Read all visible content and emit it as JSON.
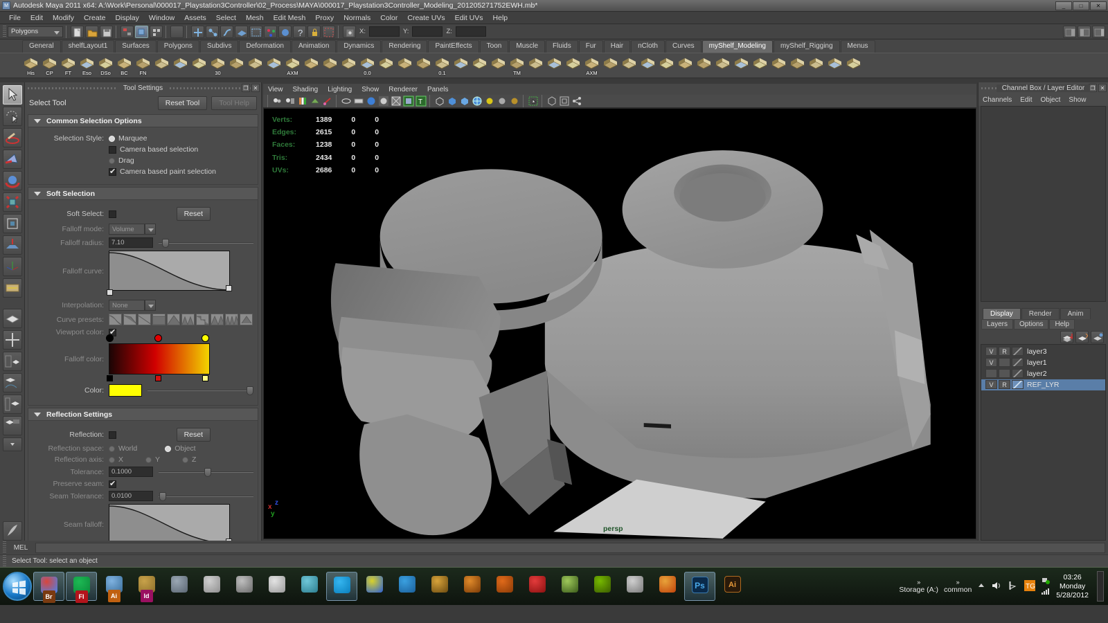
{
  "titlebar": {
    "title": "Autodesk Maya 2011 x64: A:\\Work\\Personal\\000017_Playstation3Controller\\02_Process\\MAYA\\000017_Playstation3Controller_Modeling_201205271752EWH.mb*",
    "minimize": "_",
    "maximize": "□",
    "close": "✕"
  },
  "menubar": {
    "items": [
      "File",
      "Edit",
      "Modify",
      "Create",
      "Display",
      "Window",
      "Assets",
      "Select",
      "Mesh",
      "Edit Mesh",
      "Proxy",
      "Normals",
      "Color",
      "Create UVs",
      "Edit UVs",
      "Help"
    ]
  },
  "statusline": {
    "menuset": "Polygons",
    "coord_labels": [
      "X:",
      "Y:",
      "Z:"
    ],
    "coord_values": [
      "",
      "",
      ""
    ]
  },
  "shelf": {
    "tabs": [
      "General",
      "shelfLayout1",
      "Surfaces",
      "Polygons",
      "Subdivs",
      "Deformation",
      "Animation",
      "Dynamics",
      "Rendering",
      "PaintEffects",
      "Toon",
      "Muscle",
      "Fluids",
      "Fur",
      "Hair",
      "nCloth",
      "Curves",
      "myShelf_Modeling",
      "myShelf_Rigging",
      "Menus"
    ],
    "active_tab": "myShelf_Modeling",
    "button_labels": [
      "His",
      "CP",
      "FT",
      "Eso",
      "DSo",
      "BC",
      "FN"
    ],
    "extra_labels": [
      "30",
      "AXM",
      "0.0",
      "0.1",
      "TM",
      "AXM"
    ]
  },
  "toolsettings": {
    "panel_title": "Tool Settings",
    "tool_name": "Select Tool",
    "reset_tool": "Reset Tool",
    "tool_help": "Tool Help",
    "common": {
      "frame": "Common Selection Options",
      "selection_style_label": "Selection Style:",
      "marquee": "Marquee",
      "camera_based_selection": "Camera based selection",
      "drag": "Drag",
      "camera_based_paint_selection": "Camera based paint selection",
      "marquee_checked": true,
      "drag_checked": false,
      "cbs_checked": false,
      "cbps_checked": true
    },
    "soft": {
      "frame": "Soft Selection",
      "soft_select_label": "Soft Select:",
      "reset": "Reset",
      "falloff_mode_label": "Falloff mode:",
      "falloff_mode_value": "Volume",
      "falloff_radius_label": "Falloff radius:",
      "falloff_radius_value": "7.10",
      "falloff_curve_label": "Falloff curve:",
      "interpolation_label": "Interpolation:",
      "interpolation_value": "None",
      "curve_presets_label": "Curve presets:",
      "viewport_color_label": "Viewport color:",
      "viewport_color_checked": true,
      "falloff_color_label": "Falloff color:",
      "color_label": "Color:",
      "color_value": "#ffff00",
      "gradient_stops": [
        "#000000",
        "#e00000",
        "#ffff00"
      ]
    },
    "reflection": {
      "frame": "Reflection Settings",
      "reflection_label": "Reflection:",
      "reset": "Reset",
      "space_label": "Reflection space:",
      "world": "World",
      "object": "Object",
      "space_value": "Object",
      "axis_label": "Reflection axis:",
      "axis_x": "X",
      "axis_y": "Y",
      "axis_z": "Z",
      "axis_value": "X",
      "tolerance_label": "Tolerance:",
      "tolerance_value": "0.1000",
      "preserve_seam_label": "Preserve seam:",
      "preserve_seam_checked": true,
      "seam_tolerance_label": "Seam Tolerance:",
      "seam_tolerance_value": "0.0100",
      "seam_falloff_label": "Seam falloff:"
    }
  },
  "viewport": {
    "menus": [
      "View",
      "Shading",
      "Lighting",
      "Show",
      "Renderer",
      "Panels"
    ],
    "camera_label": "persp",
    "axis": {
      "x": "x",
      "y": "y",
      "z": "z"
    },
    "hud": {
      "rows": [
        {
          "label": "Verts:",
          "c1": "1389",
          "c2": "0",
          "c3": "0"
        },
        {
          "label": "Edges:",
          "c1": "2615",
          "c2": "0",
          "c3": "0"
        },
        {
          "label": "Faces:",
          "c1": "1238",
          "c2": "0",
          "c3": "0"
        },
        {
          "label": "Tris:",
          "c1": "2434",
          "c2": "0",
          "c3": "0"
        },
        {
          "label": "UVs:",
          "c1": "2686",
          "c2": "0",
          "c3": "0"
        }
      ]
    }
  },
  "channelbox": {
    "panel_title": "Channel Box / Layer Editor",
    "menus": [
      "Channels",
      "Edit",
      "Object",
      "Show"
    ]
  },
  "layers": {
    "tabs": [
      "Display",
      "Render",
      "Anim"
    ],
    "active_tab": "Display",
    "menus": [
      "Layers",
      "Options",
      "Help"
    ],
    "rows": [
      {
        "v": "V",
        "r": "R",
        "name": "layer3",
        "selected": false
      },
      {
        "v": "V",
        "r": "",
        "name": "layer1",
        "selected": false
      },
      {
        "v": "",
        "r": "",
        "name": "layer2",
        "selected": false
      },
      {
        "v": "V",
        "r": "R",
        "name": "REF_LYR",
        "selected": true
      }
    ]
  },
  "bottom": {
    "mel_label": "MEL",
    "mel_value": "",
    "help_line": "Select Tool: select an object"
  },
  "taskbar": {
    "toolbar_labels": [
      "Storage (A:)",
      "common"
    ],
    "overflow": "»",
    "clock_time": "03:26",
    "clock_day": "Monday",
    "clock_date": "5/28/2012"
  },
  "colors": {
    "accent_blue": "#5a7ea8",
    "hud_green": "#2f7a3a",
    "panel_bg": "#4b4b4b",
    "titlebar": "#6e6e6e"
  }
}
